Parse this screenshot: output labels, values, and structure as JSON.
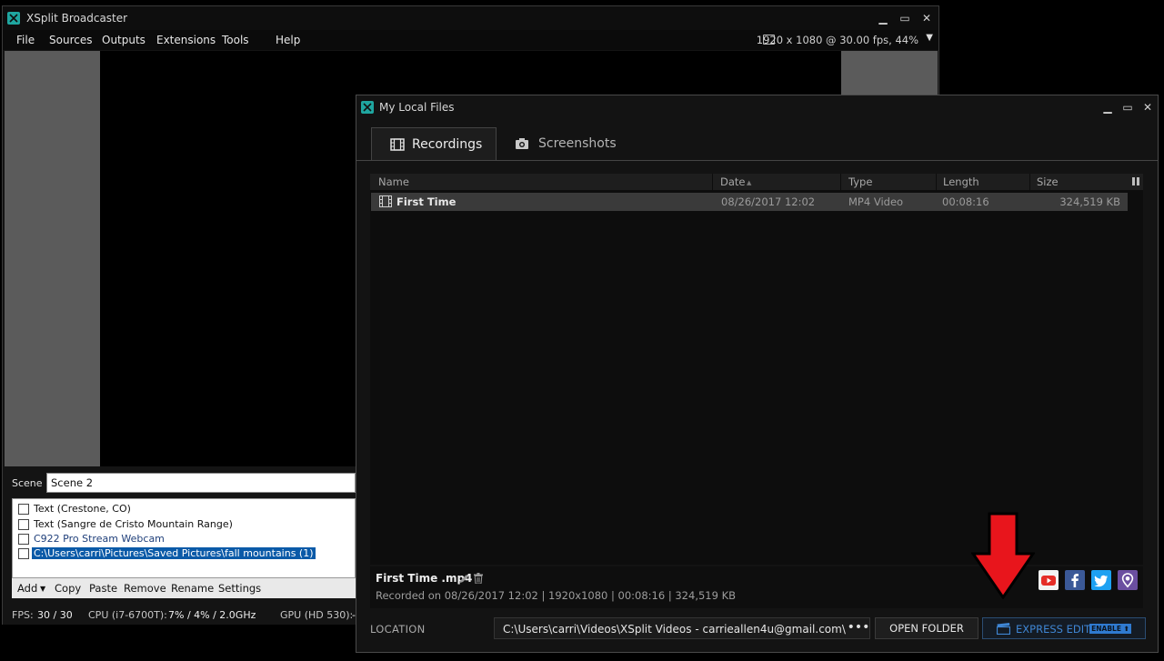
{
  "main_window": {
    "title": "XSplit Broadcaster",
    "menu": [
      "File",
      "Sources",
      "Outputs",
      "Extensions",
      "Tools",
      "Help"
    ],
    "resolution": "1920 x 1080 @ 30.00 fps, 44%",
    "scene_label": "Scene",
    "scene_name": "Scene 2",
    "sources": [
      {
        "label": "Text (Crestone, CO)",
        "checked": false,
        "selected": false
      },
      {
        "label": "Text (Sangre de Cristo Mountain Range)",
        "checked": false,
        "selected": false
      },
      {
        "label": "C922 Pro Stream Webcam",
        "checked": false,
        "selected": false
      },
      {
        "label": "C:\\Users\\carri\\Pictures\\Saved Pictures\\fall mountains (1)",
        "checked": false,
        "selected": true
      }
    ],
    "source_toolbar": [
      "Add",
      "Copy",
      "Paste",
      "Remove",
      "Rename",
      "Settings"
    ],
    "status": {
      "fps_label": "FPS:",
      "fps_value": "30 / 30",
      "cpu_label": "CPU (i7-6700T):",
      "cpu_value": "7% / 4% / 2.0GHz",
      "gpu_label": "GPU (HD 530):",
      "gpu_value": "-"
    }
  },
  "files_window": {
    "title": "My Local Files",
    "tabs": [
      {
        "label": "Recordings",
        "active": true
      },
      {
        "label": "Screenshots",
        "active": false
      }
    ],
    "columns": [
      "Name",
      "Date",
      "Type",
      "Length",
      "Size"
    ],
    "rows": [
      {
        "name": "First Time",
        "date": "08/26/2017 12:02",
        "type": "MP4 Video",
        "length": "00:08:16",
        "size": "324,519 KB"
      }
    ],
    "selected": {
      "name": "First Time .mp4",
      "meta": "Recorded on 08/26/2017 12:02 | 1920x1080 | 00:08:16 | 324,519 KB"
    },
    "location_label": "LOCATION",
    "location_path": "C:\\Users\\carri\\Videos\\XSplit Videos - carrieallen4u@gmail.com\\",
    "open_folder": "OPEN FOLDER",
    "express_edit": "EXPRESS EDIT",
    "express_badge": "ENABLE ⬆",
    "share_icons": [
      "youtube-icon",
      "facebook-icon",
      "twitter-icon",
      "periscope-icon"
    ]
  },
  "colors": {
    "accent_blue": "#3f86d4",
    "arrow_red": "#e8151c",
    "selection_blue": "#0a5aa8"
  }
}
